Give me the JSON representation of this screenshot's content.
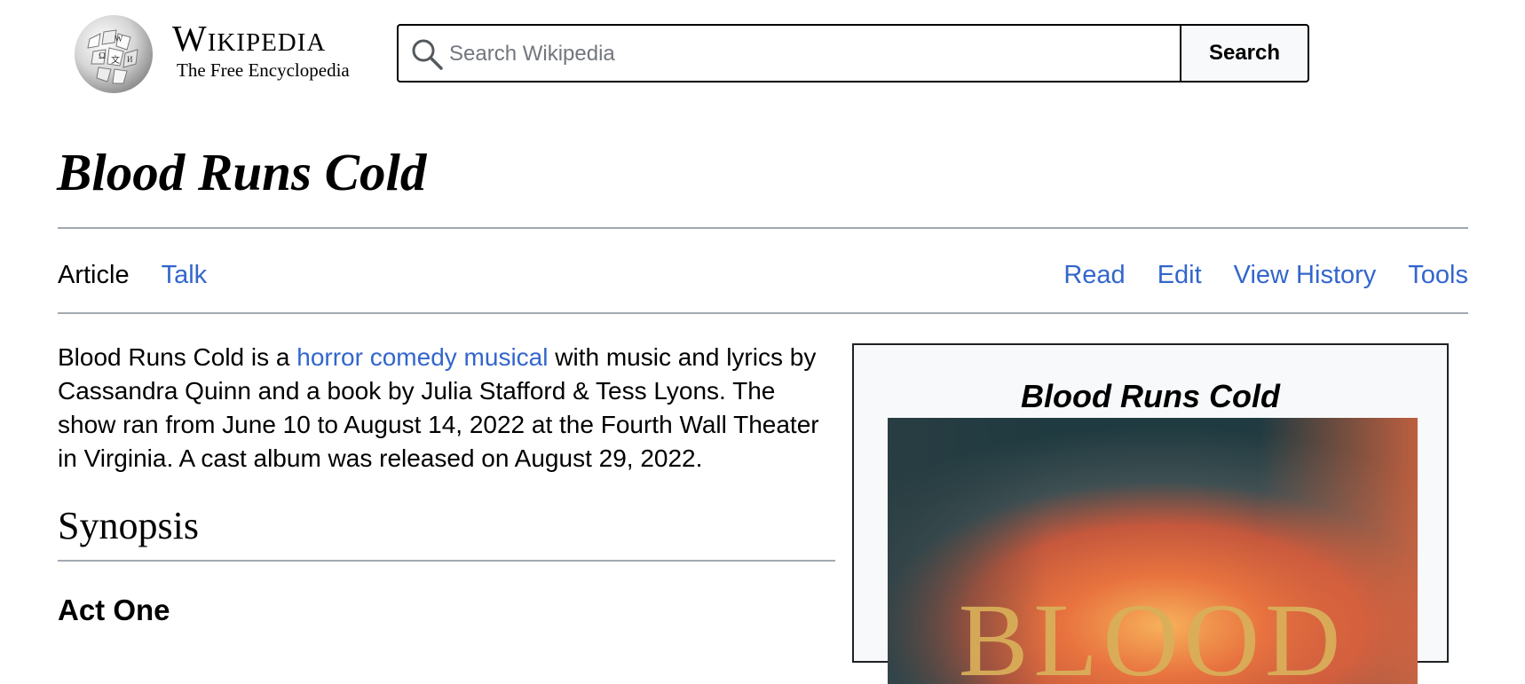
{
  "header": {
    "wordmark_title": "Wikipedia",
    "wordmark_tagline": "The Free Encyclopedia",
    "search_placeholder": "Search Wikipedia",
    "search_button": "Search"
  },
  "page": {
    "title": "Blood Runs Cold",
    "tabs_left": [
      "Article",
      "Talk"
    ],
    "tabs_right": [
      "Read",
      "Edit",
      "View History",
      "Tools"
    ]
  },
  "article": {
    "intro_before": "Blood Runs Cold is a ",
    "intro_link": "horror comedy musical",
    "intro_after": " with music and lyrics by Cassandra Quinn and a book by Julia Stafford & Tess Lyons. The show ran from June 10 to August 14, 2022 at the Fourth Wall Theater in Virginia. A cast album was released on August 29, 2022.",
    "section_heading": "Synopsis",
    "subsection_heading": "Act One"
  },
  "infobox": {
    "title": "Blood Runs Cold",
    "poster_text": "BLOOD"
  },
  "colors": {
    "link": "#3366cc",
    "rule": "#a2a9b1",
    "infobox_bg": "#f8f9fa"
  },
  "icons": {
    "logo": "wikipedia-globe-icon",
    "search": "search-icon"
  }
}
